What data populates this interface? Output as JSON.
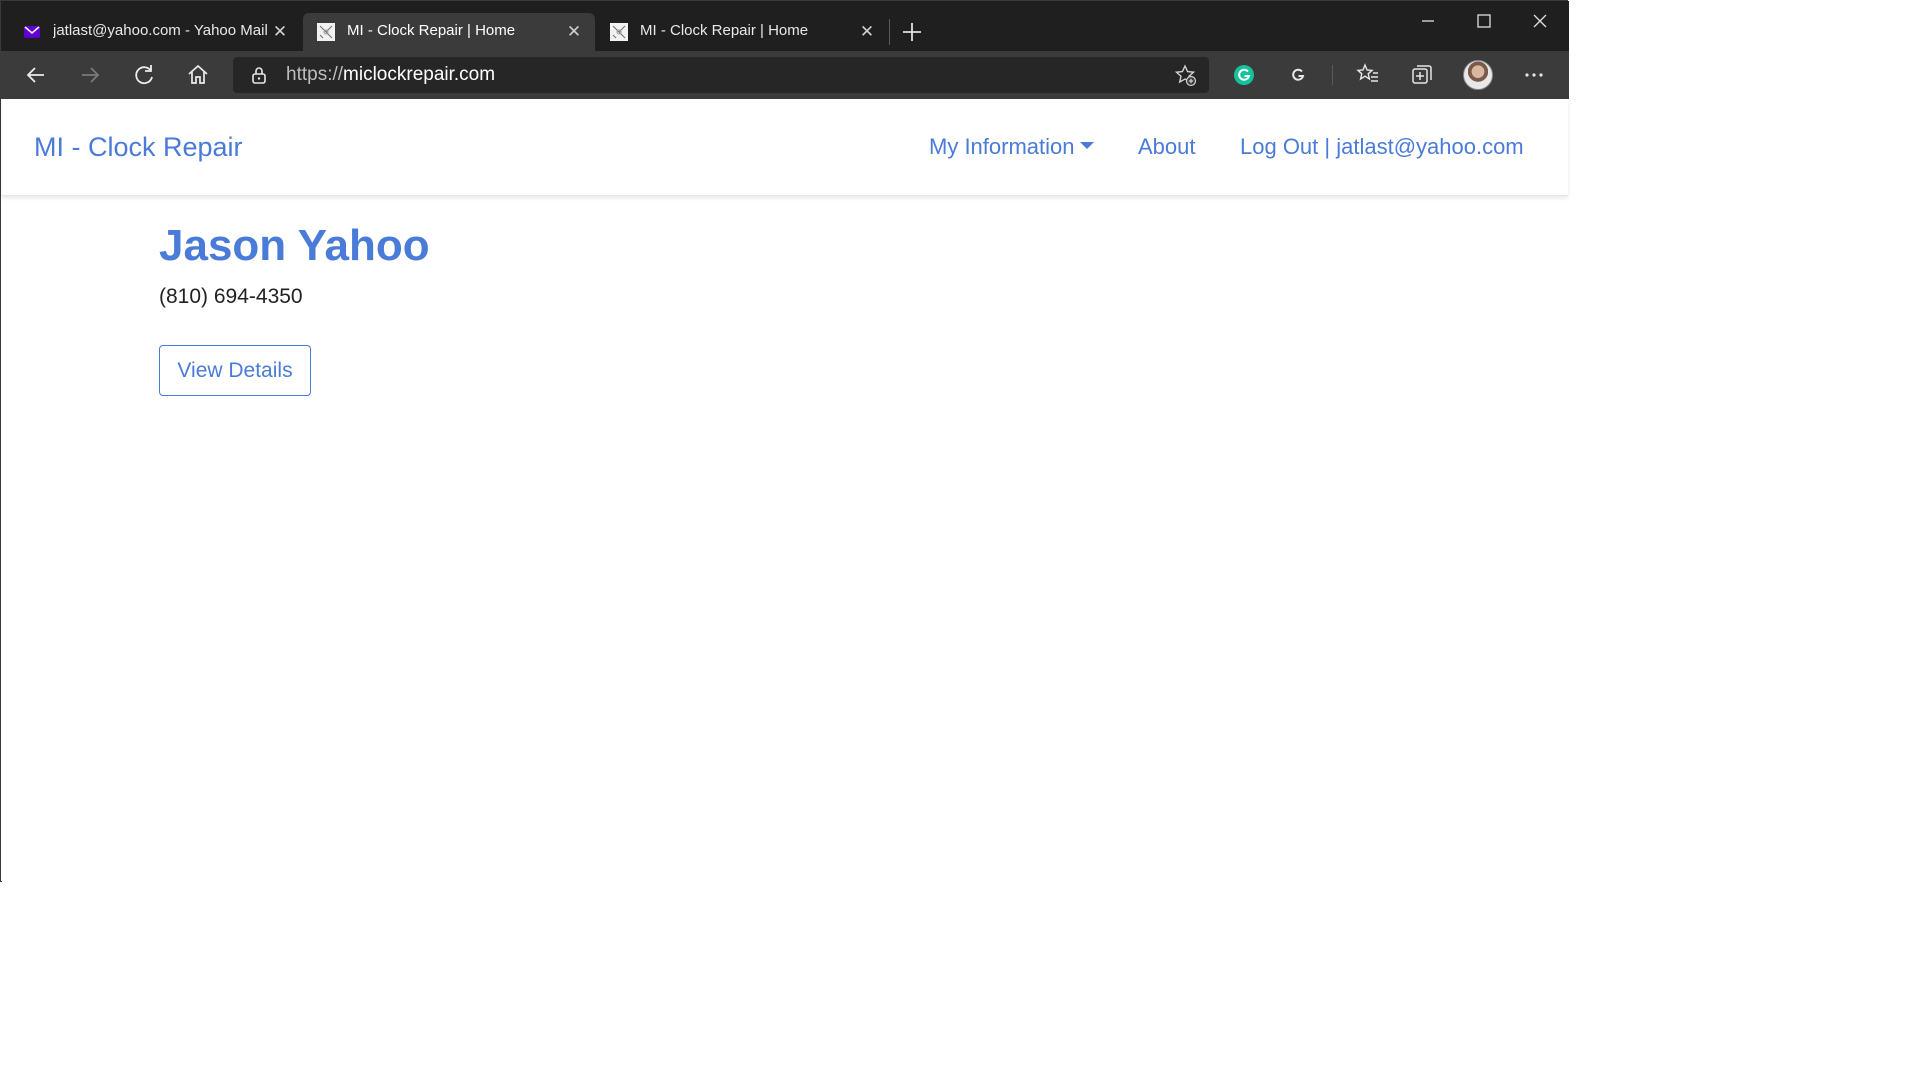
{
  "browser": {
    "tabs": [
      {
        "title": "jatlast@yahoo.com - Yahoo Mail",
        "favicon": "yahoo-mail-icon",
        "active": false
      },
      {
        "title": "MI - Clock Repair | Home",
        "favicon": "site-icon",
        "active": true
      },
      {
        "title": "MI - Clock Repair | Home",
        "favicon": "site-icon",
        "active": false
      }
    ],
    "close_glyph": "✕",
    "url_scheme": "https://",
    "url_host": "miclockrepair.com"
  },
  "site": {
    "brand": "MI - Clock Repair",
    "nav": {
      "my_information": "My Information",
      "about": "About",
      "logout": "Log Out | jatlast@yahoo.com"
    },
    "profile": {
      "name": "Jason Yahoo",
      "phone": "(810) 694-4350",
      "view_details": "View Details"
    },
    "colors": {
      "accent": "#4a7bd8",
      "chrome_dark": "#1f1f1f",
      "chrome_toolbar": "#3b3b3b",
      "grammarly": "#15c39a"
    }
  }
}
